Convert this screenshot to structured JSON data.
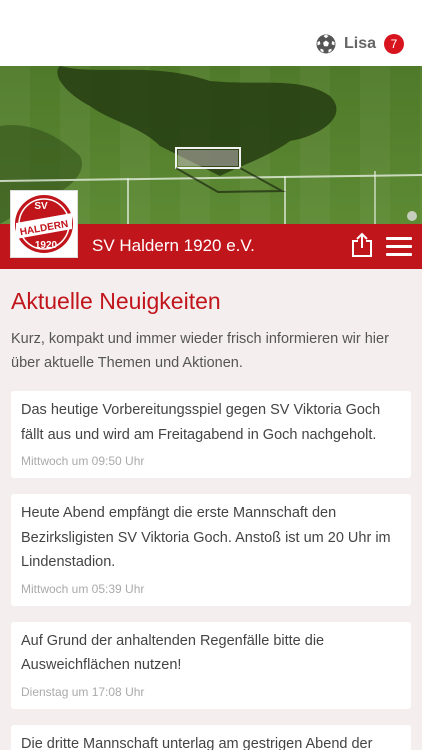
{
  "user": {
    "name": "Lisa",
    "notification_count": "7"
  },
  "club": {
    "name": "SV Haldern 1920 e.V.",
    "logo_text_top": "SV",
    "logo_text_middle": "HALDERN",
    "logo_text_bottom": "1920"
  },
  "news": {
    "heading": "Aktuelle Neuigkeiten",
    "intro": "Kurz, kompakt und immer wieder frisch informieren wir hier über aktuelle Themen und Aktionen.",
    "items": [
      {
        "text": "Das heutige Vorbereitungsspiel gegen SV Viktoria Goch fällt aus und wird am Freitagabend in Goch nachgeholt.",
        "time": "Mittwoch um 09:50 Uhr"
      },
      {
        "text": "Heute Abend empfängt die erste Mannschaft den Bezirksligisten SV Viktoria Goch. Anstoß ist um 20 Uhr im Lindenstadion.",
        "time": "Mittwoch um 05:39 Uhr"
      },
      {
        "text": "Auf Grund der anhaltenden Regenfälle bitte die Ausweichflächen nutzen!",
        "time": "Dienstag um 17:08 Uhr"
      },
      {
        "text": "Die dritte Mannschaft unterlag am gestrigen Abend der",
        "time": ""
      }
    ]
  },
  "icons": {
    "user": "soccer-ball-icon",
    "share": "share-icon",
    "menu": "hamburger-menu-icon"
  },
  "colors": {
    "brand_red": "#c1151c",
    "badge_red": "#d8141e",
    "background": "#f4eeee"
  }
}
